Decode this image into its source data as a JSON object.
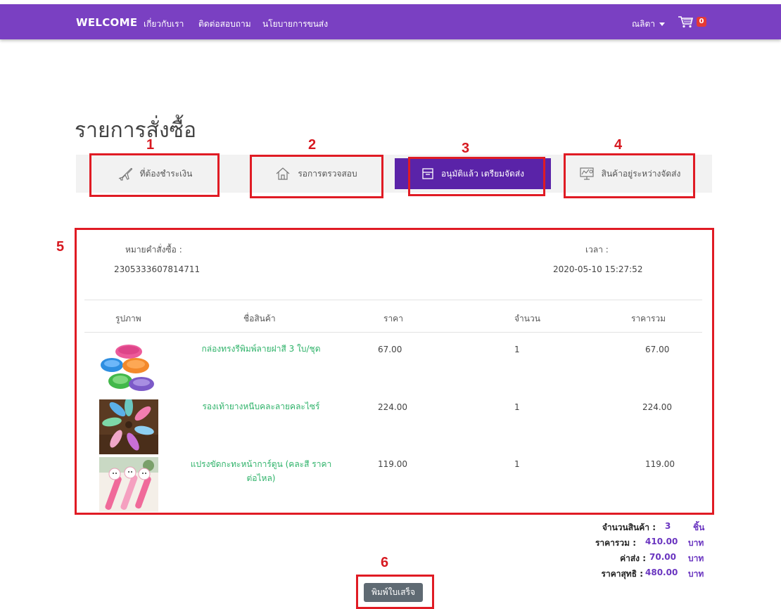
{
  "navbar": {
    "brand": "WELCOME",
    "links": [
      "เกี่ยวกับเรา",
      "ติดต่อสอบถาม",
      "นโยบายการขนส่ง"
    ],
    "user": "ณลิตา",
    "cart_count": "0",
    "bg_color": "#7a40c2"
  },
  "page_title": "รายการสั่งซื้อ",
  "tabs": [
    {
      "label": "ที่ต้องชำระเงิน",
      "icon": "airplane-icon"
    },
    {
      "label": "รอการตรวจสอบ",
      "icon": "home-icon"
    },
    {
      "label": "อนุมัติแล้ว เตรียมจัดส่ง",
      "icon": "archive-box-icon",
      "active": true
    },
    {
      "label": "สินค้าอยู่ระหว่างจัดส่ง",
      "icon": "presentation-chart-icon"
    }
  ],
  "markers": [
    "1",
    "2",
    "3",
    "4",
    "5",
    "6"
  ],
  "order": {
    "number_label": "หมายคำสั่งซื้อ :",
    "number": "2305333607814711",
    "time_label": "เวลา :",
    "time": "2020-05-10 15:27:52"
  },
  "table": {
    "headers": [
      "รูปภาพ",
      "ชื่อสินค้า",
      "ราคา",
      "จำนวน",
      "ราคารวม"
    ],
    "rows": [
      {
        "name": "กล่องทรงรีพิมพ์ลายฝาสี 3 ใบ/ชุด",
        "price": "67.00",
        "qty": "1",
        "total": "67.00",
        "image": "colorful-oval-boxes"
      },
      {
        "name": "รองเท้ายางหนีบคละลายคละไซร์",
        "price": "224.00",
        "qty": "1",
        "total": "224.00",
        "image": "flip-flops"
      },
      {
        "name": "แปรงขัดกะทะหน้าการ์ตูน (คละสี ราคาต่อไหล)",
        "price": "119.00",
        "qty": "1",
        "total": "119.00",
        "image": "cartoon-brushes"
      }
    ]
  },
  "summary": {
    "qty_label": "จำนวนสินค้า :",
    "qty_value": "3",
    "qty_unit": "ชิ้น",
    "subtotal_label": "ราคารวม :",
    "subtotal_value": "410.00",
    "shipping_label": "ค่าส่ง :",
    "shipping_value": "70.00",
    "grand_label": "ราคาสุทธิ :",
    "grand_value": "480.00",
    "currency": "บาท"
  },
  "print_button": "พิมพ์ใบเสร็จ",
  "colors": {
    "accent": "#6a35c0",
    "active_tab": "#5a23a8",
    "marker": "#e01b24",
    "link_green": "#2fb36a"
  }
}
